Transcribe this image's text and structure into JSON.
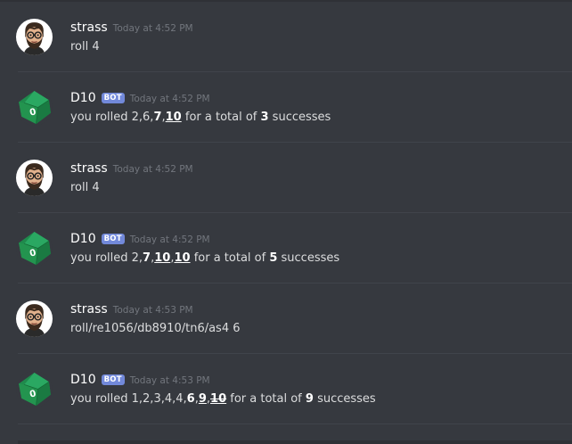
{
  "colors": {
    "background": "#36393f",
    "bot_badge": "#7289da",
    "username": "#ffffff",
    "timestamp": "#72767d",
    "text": "#dcddde"
  },
  "messages": [
    {
      "author": "strass",
      "is_bot": false,
      "avatar_icon": "bearded-man-avatar",
      "timestamp": "Today at 4:52 PM",
      "segments": [
        {
          "text": "roll 4",
          "style": "plain"
        }
      ]
    },
    {
      "author": "D10",
      "is_bot": true,
      "bot_label": "BOT",
      "avatar_icon": "green-d10-die-avatar",
      "timestamp": "Today at 4:52 PM",
      "segments": [
        {
          "text": "you rolled 2,6,",
          "style": "plain"
        },
        {
          "text": "7",
          "style": "bold"
        },
        {
          "text": ",",
          "style": "plain"
        },
        {
          "text": "10",
          "style": "bold-underline"
        },
        {
          "text": " for a total of ",
          "style": "plain"
        },
        {
          "text": "3",
          "style": "bold"
        },
        {
          "text": " successes",
          "style": "plain"
        }
      ]
    },
    {
      "author": "strass",
      "is_bot": false,
      "avatar_icon": "bearded-man-avatar",
      "timestamp": "Today at 4:52 PM",
      "segments": [
        {
          "text": "roll 4",
          "style": "plain"
        }
      ]
    },
    {
      "author": "D10",
      "is_bot": true,
      "bot_label": "BOT",
      "avatar_icon": "green-d10-die-avatar",
      "timestamp": "Today at 4:52 PM",
      "segments": [
        {
          "text": "you rolled 2,",
          "style": "plain"
        },
        {
          "text": "7",
          "style": "bold"
        },
        {
          "text": ",",
          "style": "plain"
        },
        {
          "text": "10",
          "style": "bold-underline"
        },
        {
          "text": ",",
          "style": "plain"
        },
        {
          "text": "10",
          "style": "bold-underline"
        },
        {
          "text": " for a total of ",
          "style": "plain"
        },
        {
          "text": "5",
          "style": "bold"
        },
        {
          "text": " successes",
          "style": "plain"
        }
      ]
    },
    {
      "author": "strass",
      "is_bot": false,
      "avatar_icon": "bearded-man-avatar",
      "timestamp": "Today at 4:53 PM",
      "segments": [
        {
          "text": "roll/re1056/db8910/tn6/as4 6",
          "style": "plain"
        }
      ]
    },
    {
      "author": "D10",
      "is_bot": true,
      "bot_label": "BOT",
      "avatar_icon": "green-d10-die-avatar",
      "timestamp": "Today at 4:53 PM",
      "segments": [
        {
          "text": "you rolled 1,2,3,4,4,",
          "style": "plain"
        },
        {
          "text": "6",
          "style": "bold"
        },
        {
          "text": ",",
          "style": "plain"
        },
        {
          "text": "9",
          "style": "bold-underline"
        },
        {
          "text": ",",
          "style": "plain"
        },
        {
          "text": "10",
          "style": "bold-underline-strike"
        },
        {
          "text": " for a total of ",
          "style": "plain"
        },
        {
          "text": "9",
          "style": "bold"
        },
        {
          "text": " successes",
          "style": "plain"
        }
      ]
    }
  ]
}
